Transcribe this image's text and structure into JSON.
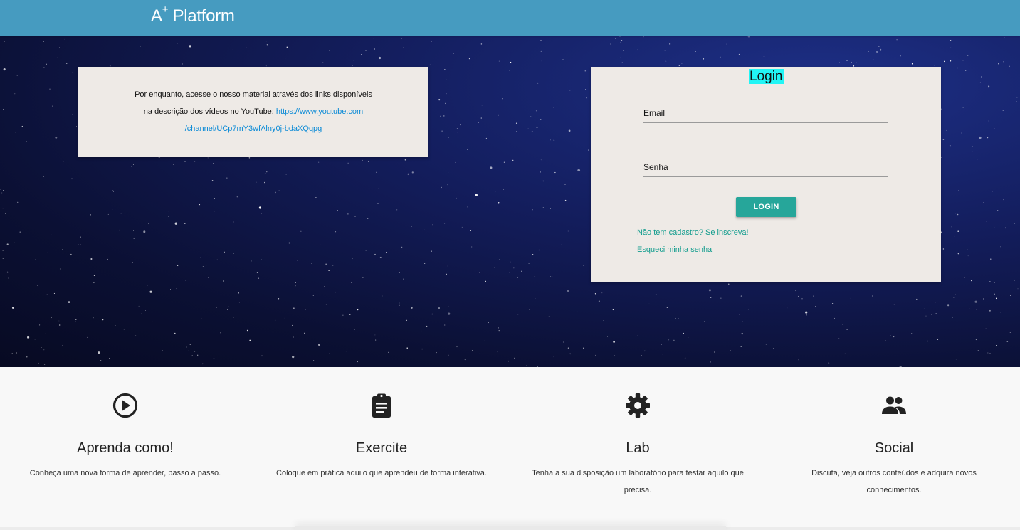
{
  "header": {
    "brand_main": "A",
    "brand_sup": "+",
    "brand_rest": " Platform",
    "color": "#469bc0"
  },
  "info": {
    "line1": "Por enquanto, acesse o nosso material através dos links disponíveis",
    "line2_prefix": "na descrição dos vídeos no YouTube: ",
    "link_part1": "https://www.youtube.com",
    "link_part2": "/channel/UCp7mY3wfAlny0j-bdaXQqpg"
  },
  "login": {
    "title": "Login",
    "email_label": "Email",
    "password_label": "Senha",
    "button_label": "LOGIN",
    "signup_link": "Não tem cadastro? Se inscreva!",
    "forgot_link": "Esqueci minha senha",
    "accent": "#26a69a"
  },
  "features": [
    {
      "icon": "play-circle-icon",
      "title": "Aprenda como!",
      "description": "Conheça uma nova forma de aprender, passo a passo."
    },
    {
      "icon": "clipboard-icon",
      "title": "Exercite",
      "description": "Coloque em prática aquilo que aprendeu de forma interativa."
    },
    {
      "icon": "gear-icon",
      "title": "Lab",
      "description": "Tenha a sua disposição um laboratório para testar aquilo que precisa."
    },
    {
      "icon": "people-icon",
      "title": "Social",
      "description": "Discuta, veja outros conteúdos e adquira novos conhecimentos."
    }
  ]
}
